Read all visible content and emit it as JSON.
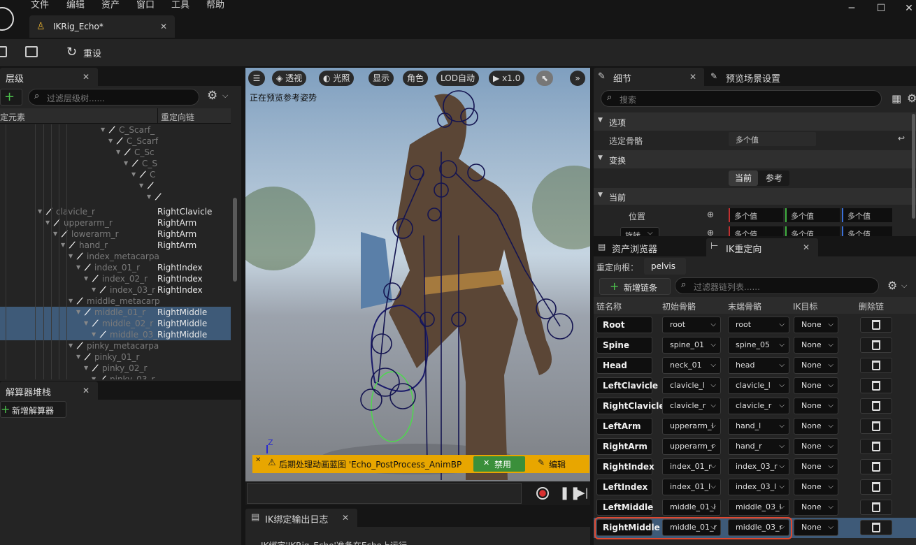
{
  "menu": [
    "文件",
    "编辑",
    "资产",
    "窗口",
    "工具",
    "帮助"
  ],
  "document_tab": "IKRig_Echo*",
  "toolbar": {
    "reset_label": "重设"
  },
  "hierarchy": {
    "tab_title": "层级",
    "filter_placeholder": "过滤层级树......",
    "col_element": "定元素",
    "col_chain": "重定向链",
    "rows": [
      {
        "name": "C_Scarf_",
        "chain": "",
        "indent": 0
      },
      {
        "name": "C_Scarf",
        "chain": "",
        "indent": 1
      },
      {
        "name": "C_Sc",
        "chain": "",
        "indent": 2
      },
      {
        "name": "C_S",
        "chain": "",
        "indent": 3
      },
      {
        "name": "C",
        "chain": "",
        "indent": 4
      },
      {
        "name": "",
        "chain": "",
        "indent": 5
      },
      {
        "name": "",
        "chain": "",
        "indent": 6
      },
      {
        "name": "clavicle_r",
        "chain": "RightClavicle",
        "indent": 0
      },
      {
        "name": "upperarm_r",
        "chain": "RightArm",
        "indent": 1
      },
      {
        "name": "lowerarm_r",
        "chain": "RightArm",
        "indent": 2
      },
      {
        "name": "hand_r",
        "chain": "RightArm",
        "indent": 3
      },
      {
        "name": "index_metacarpa",
        "chain": "",
        "indent": 4
      },
      {
        "name": "index_01_r",
        "chain": "RightIndex",
        "indent": 5
      },
      {
        "name": "index_02_r",
        "chain": "RightIndex",
        "indent": 6
      },
      {
        "name": "index_03_r",
        "chain": "RightIndex",
        "indent": 7
      },
      {
        "name": "middle_metacarp",
        "chain": "",
        "indent": 4
      },
      {
        "name": "middle_01_r",
        "chain": "RightMiddle",
        "indent": 5
      },
      {
        "name": "middle_02_r",
        "chain": "RightMiddle",
        "indent": 6
      },
      {
        "name": "middle_03_r",
        "chain": "RightMiddle",
        "indent": 7
      },
      {
        "name": "pinky_metacarpa",
        "chain": "",
        "indent": 4
      },
      {
        "name": "pinky_01_r",
        "chain": "",
        "indent": 5
      },
      {
        "name": "pinky_02_r",
        "chain": "",
        "indent": 6
      },
      {
        "name": "pinky_03_r",
        "chain": "",
        "indent": 7
      }
    ]
  },
  "solver": {
    "tab_title": "解算器堆栈",
    "add_label": "新增解算器"
  },
  "viewport": {
    "perspective": "透视",
    "lighting": "光照",
    "show": "显示",
    "character": "角色",
    "lod": "LOD自动",
    "speed": "x1.0",
    "status": "正在预览参考姿势",
    "axis_z": "Z",
    "warning": "后期处理动画蓝图 'Echo_PostProcess_AnimBP",
    "disable": "禁用",
    "edit": "编辑"
  },
  "log": {
    "tab_title": "IK绑定输出日志",
    "line": "IK绑定'IKRig_Echo'准备在Echo上运行"
  },
  "details": {
    "tab_title": "细节",
    "preview_tab": "预览场景设置",
    "search_placeholder": "搜索",
    "section_options": "选项",
    "selected_bone_label": "选定骨骼",
    "selected_bone_value": "多个值",
    "section_transform": "变换",
    "current": "当前",
    "reference": "参考",
    "section_current": "当前",
    "position_label": "位置",
    "rotation_label": "旋转",
    "multi": "多个值"
  },
  "asset_browser_tab": "资产浏览器",
  "retarget": {
    "tab_title": "IK重定向",
    "root_label": "重定向根：",
    "root_value": "pelvis",
    "add_chain": "新增链条",
    "filter_placeholder": "过滤器链列表......",
    "headers": [
      "链名称",
      "初始骨骼",
      "末端骨骼",
      "IK目标",
      "删除链"
    ],
    "chains": [
      {
        "name": "Root",
        "start": "root",
        "end": "root",
        "goal": "None"
      },
      {
        "name": "Spine",
        "start": "spine_01",
        "end": "spine_05",
        "goal": "None"
      },
      {
        "name": "Head",
        "start": "neck_01",
        "end": "head",
        "goal": "None"
      },
      {
        "name": "LeftClavicle",
        "start": "clavicle_l",
        "end": "clavicle_l",
        "goal": "None"
      },
      {
        "name": "RightClavicle",
        "start": "clavicle_r",
        "end": "clavicle_r",
        "goal": "None"
      },
      {
        "name": "LeftArm",
        "start": "upperarm_l",
        "end": "hand_l",
        "goal": "None"
      },
      {
        "name": "RightArm",
        "start": "upperarm_r",
        "end": "hand_r",
        "goal": "None"
      },
      {
        "name": "RightIndex",
        "start": "index_01_r",
        "end": "index_03_r",
        "goal": "None"
      },
      {
        "name": "LeftIndex",
        "start": "index_01_l",
        "end": "index_03_l",
        "goal": "None"
      },
      {
        "name": "LeftMiddle",
        "start": "middle_01_l",
        "end": "middle_03_l",
        "goal": "None"
      },
      {
        "name": "RightMiddle",
        "start": "middle_01_r",
        "end": "middle_03_r",
        "goal": "None"
      }
    ]
  },
  "colors": {
    "accent_selected": "#3e5a78",
    "highlight_outline": "#e0482e",
    "warning": "#e8a600",
    "disable_green": "#3a8f3a"
  }
}
